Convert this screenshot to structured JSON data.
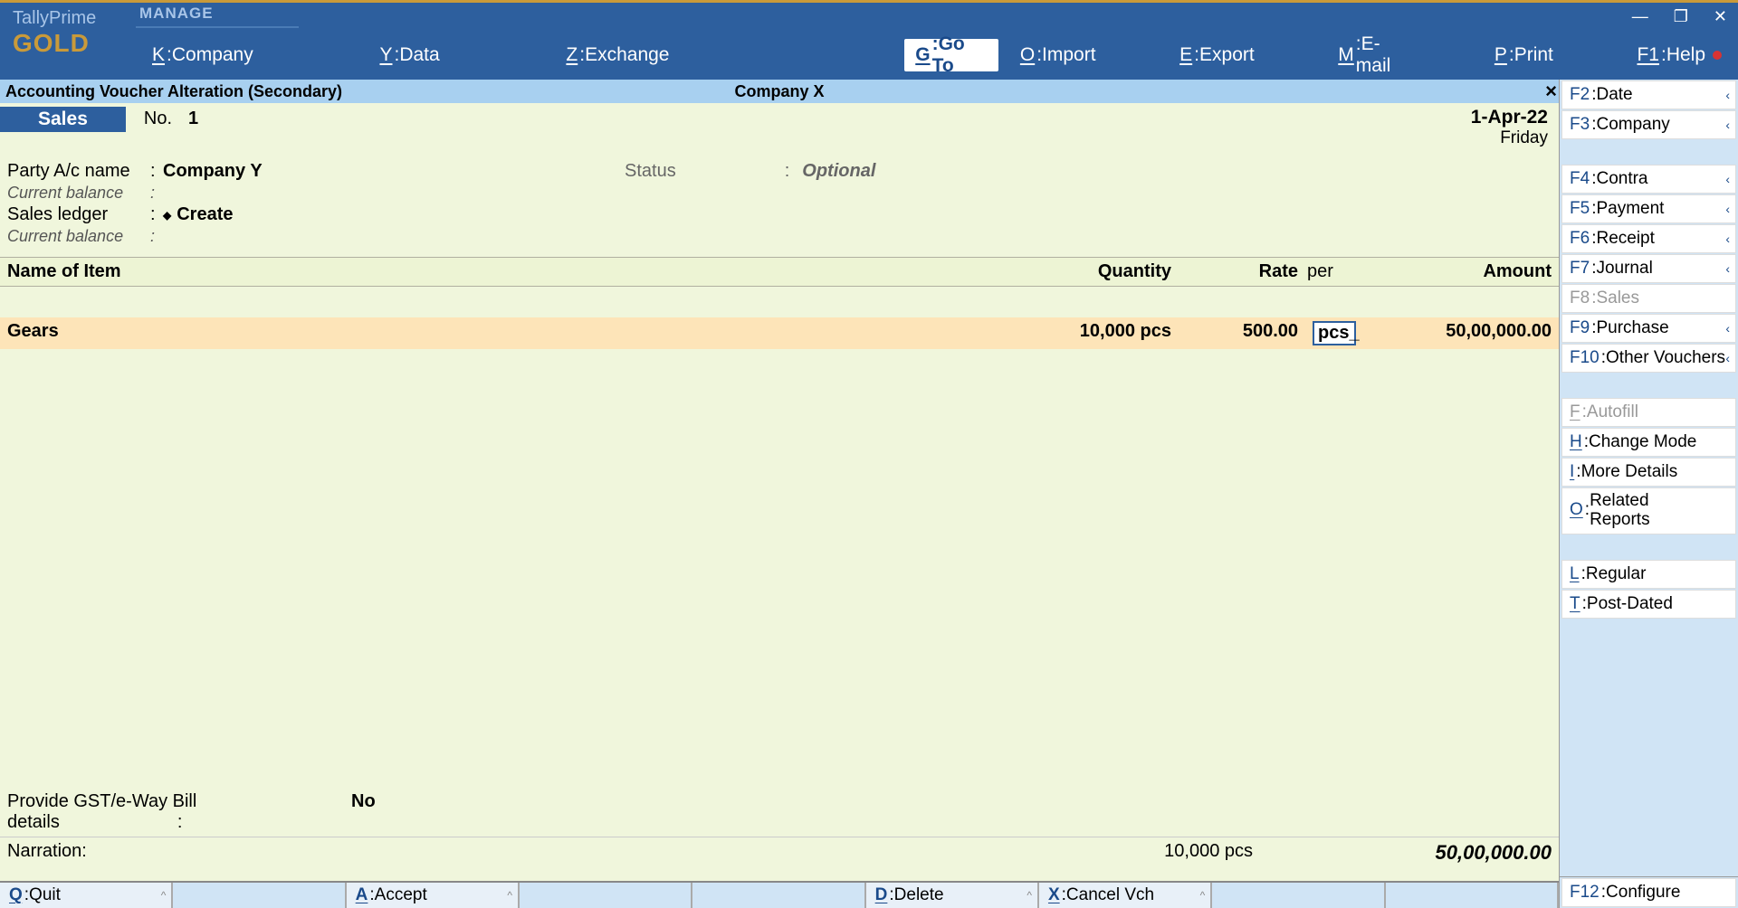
{
  "brand": {
    "name": "TallyPrime",
    "edition": "GOLD"
  },
  "topMenu": {
    "manage": "MANAGE",
    "items": [
      {
        "key": "K",
        "label": "Company"
      },
      {
        "key": "Y",
        "label": "Data"
      },
      {
        "key": "Z",
        "label": "Exchange"
      },
      {
        "key": "G",
        "label": "Go To",
        "goto": true
      },
      {
        "key": "O",
        "label": "Import"
      },
      {
        "key": "E",
        "label": "Export"
      },
      {
        "key": "M",
        "label": "E-mail"
      },
      {
        "key": "P",
        "label": "Print"
      },
      {
        "key": "F1",
        "label": "Help",
        "help": true
      }
    ]
  },
  "context": {
    "title": "Accounting Voucher Alteration (Secondary)",
    "company": "Company X"
  },
  "voucher": {
    "type": "Sales",
    "noLabel": "No.",
    "no": "1",
    "date": "1-Apr-22",
    "day": "Friday"
  },
  "party": {
    "nameLabel": "Party A/c name",
    "nameValue": "Company Y",
    "balanceLabel": "Current balance",
    "ledgerLabel": "Sales ledger",
    "ledgerValue": "Create",
    "ledgerBalanceLabel": "Current balance",
    "statusLabel": "Status",
    "statusValue": "Optional"
  },
  "gridHeaders": {
    "name": "Name of Item",
    "qty": "Quantity",
    "rate": "Rate",
    "per": "per",
    "amount": "Amount"
  },
  "items": [
    {
      "name": "Gears",
      "qty": "10,000 pcs",
      "rate": "500.00",
      "per": "pcs",
      "amount": "50,00,000.00"
    }
  ],
  "gst": {
    "label": "Provide GST/e-Way Bill details",
    "value": "No"
  },
  "totals": {
    "narration": "Narration:",
    "qty": "10,000 pcs",
    "amount": "50,00,000.00"
  },
  "bottomBar": [
    {
      "key": "Q",
      "label": "Quit"
    },
    {
      "empty": true
    },
    {
      "key": "A",
      "label": "Accept"
    },
    {
      "empty": true
    },
    {
      "empty": true
    },
    {
      "key": "D",
      "label": "Delete"
    },
    {
      "key": "X",
      "label": "Cancel Vch"
    },
    {
      "empty": true
    },
    {
      "empty": true
    }
  ],
  "sidePanel": {
    "group1": [
      {
        "key": "F2",
        "label": "Date",
        "chevron": true
      },
      {
        "key": "F3",
        "label": "Company",
        "chevron": true
      }
    ],
    "group2": [
      {
        "key": "F4",
        "label": "Contra",
        "chevron": true
      },
      {
        "key": "F5",
        "label": "Payment",
        "chevron": true
      },
      {
        "key": "F6",
        "label": "Receipt",
        "chevron": true
      },
      {
        "key": "F7",
        "label": "Journal",
        "chevron": true
      },
      {
        "key": "F8",
        "label": "Sales",
        "disabled": true
      },
      {
        "key": "F9",
        "label": "Purchase",
        "chevron": true
      },
      {
        "key": "F10",
        "label": "Other Vouchers",
        "chevron": true
      }
    ],
    "group3": [
      {
        "key": "F",
        "label": "Autofill",
        "disabled": true,
        "underline": true
      },
      {
        "key": "H",
        "label": "Change Mode",
        "underline": true
      },
      {
        "key": "I",
        "label": "More Details",
        "underline": true
      },
      {
        "key": "O",
        "label": "Related Reports",
        "underline": true,
        "multiline": true
      }
    ],
    "group4": [
      {
        "key": "L",
        "label": "Regular",
        "underline": true
      },
      {
        "key": "T",
        "label": "Post-Dated",
        "underline": true
      }
    ],
    "bottom": {
      "key": "F12",
      "label": "Configure"
    }
  }
}
